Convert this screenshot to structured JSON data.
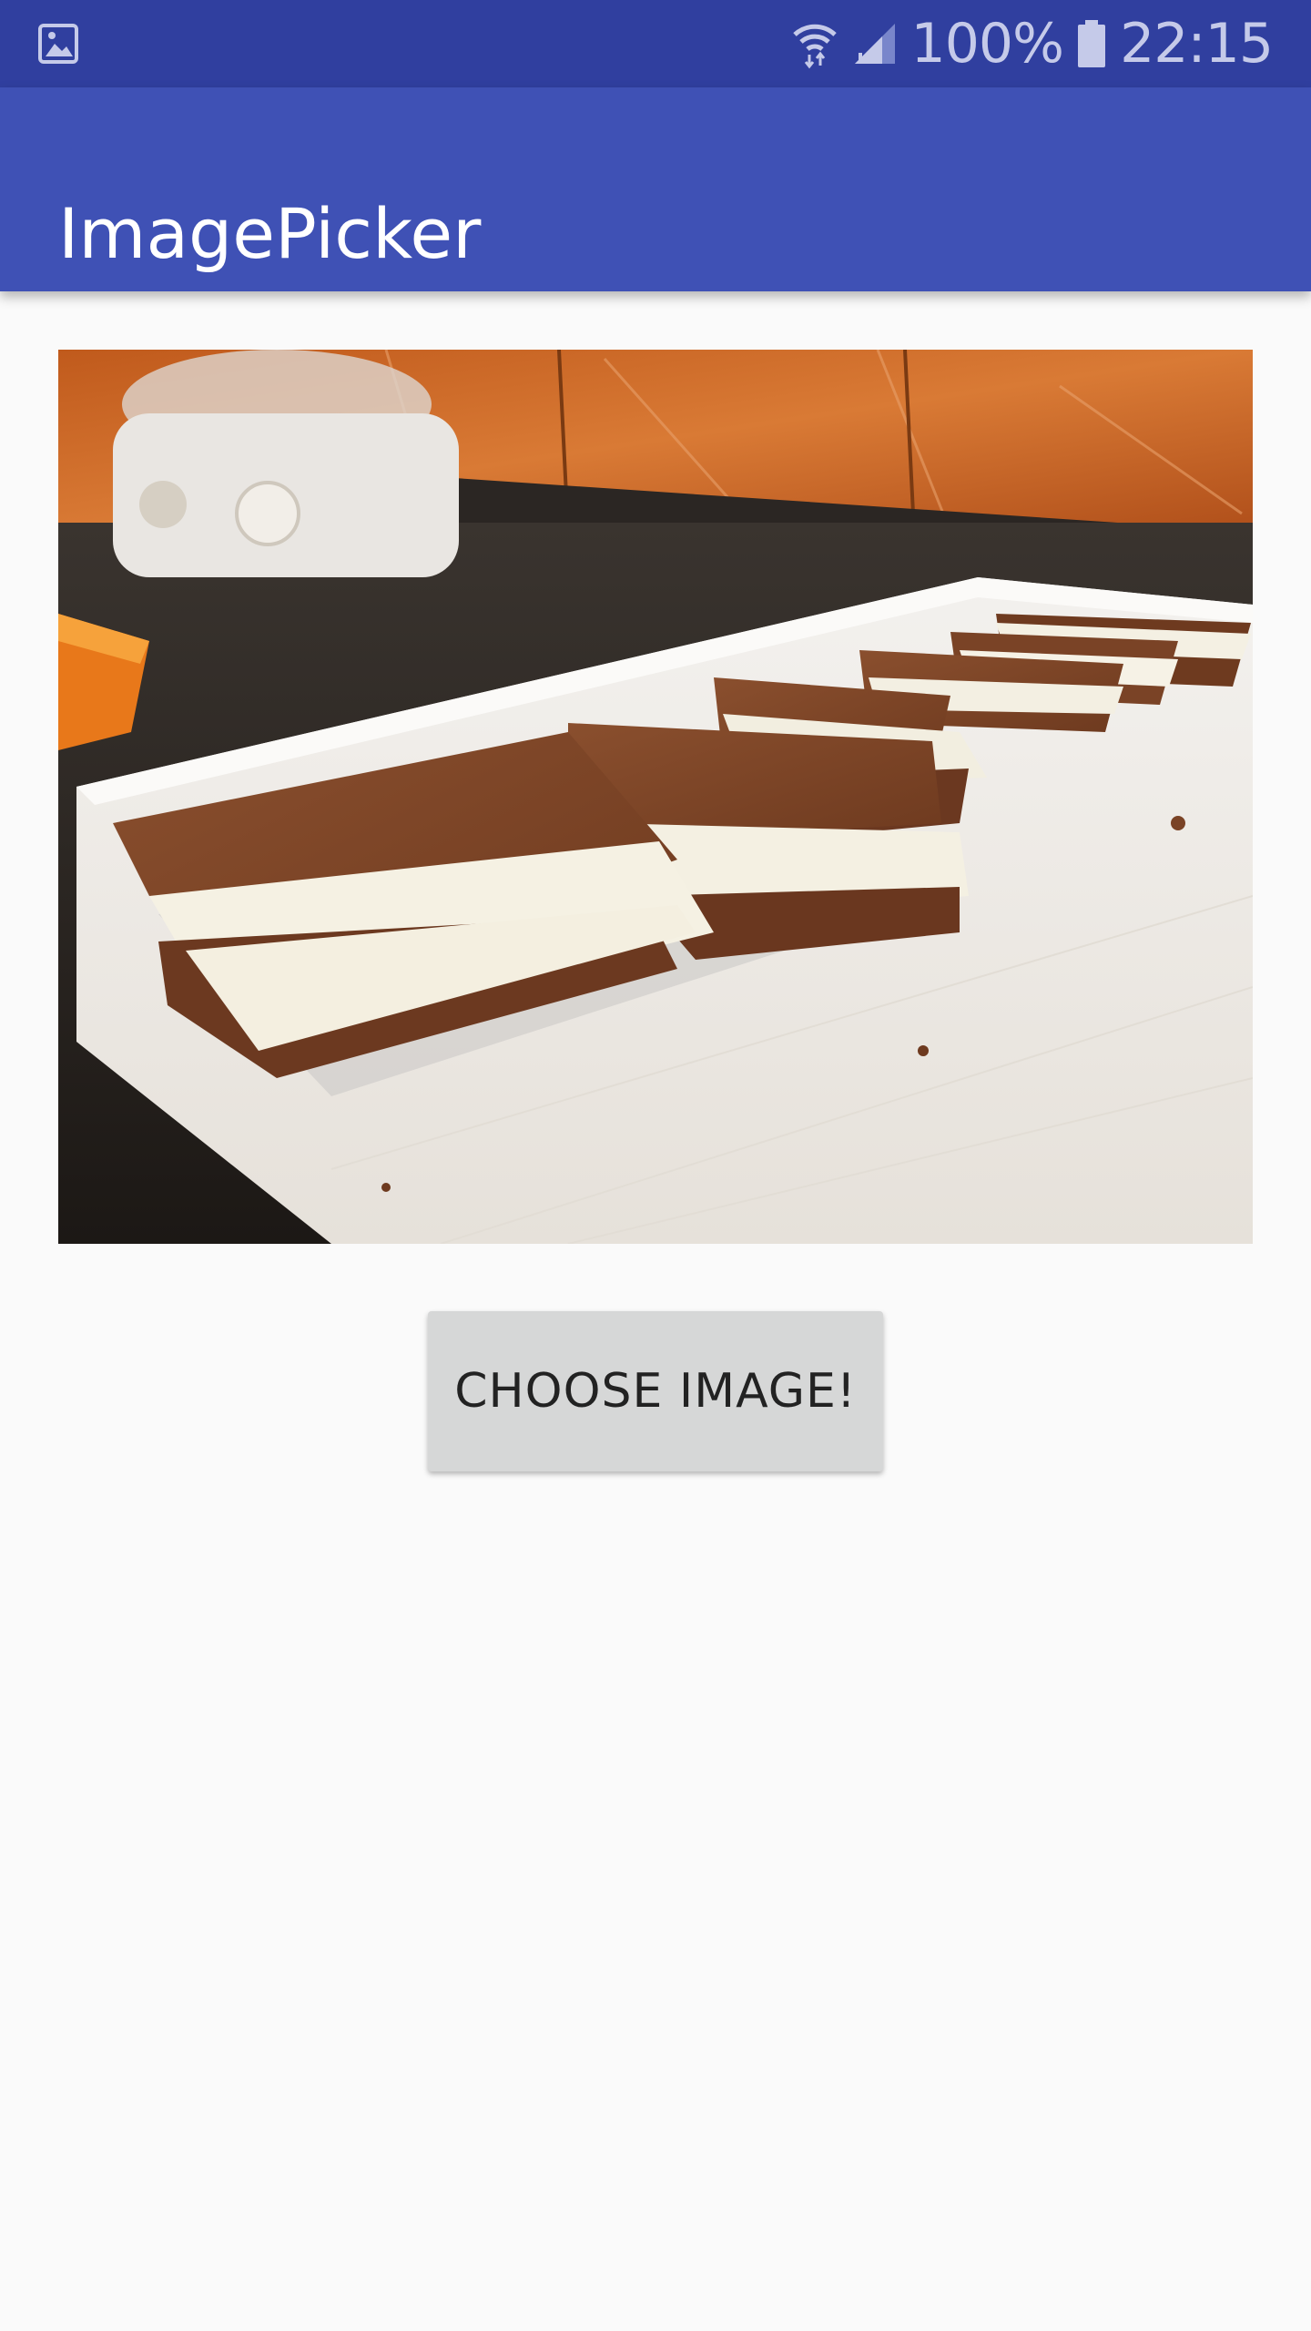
{
  "status_bar": {
    "left_icon": "image-icon",
    "wifi_icon": "wifi-icon",
    "signal_icon": "cell-signal-icon",
    "battery_percent": "100%",
    "battery_icon": "battery-icon",
    "time": "22:15"
  },
  "app_bar": {
    "title": "ImagePicker",
    "color": "#3f51b5",
    "status_color": "#303f9f"
  },
  "main": {
    "image": {
      "description_icon": "selected-photo"
    },
    "choose_button_label": "CHOOSE IMAGE!"
  }
}
